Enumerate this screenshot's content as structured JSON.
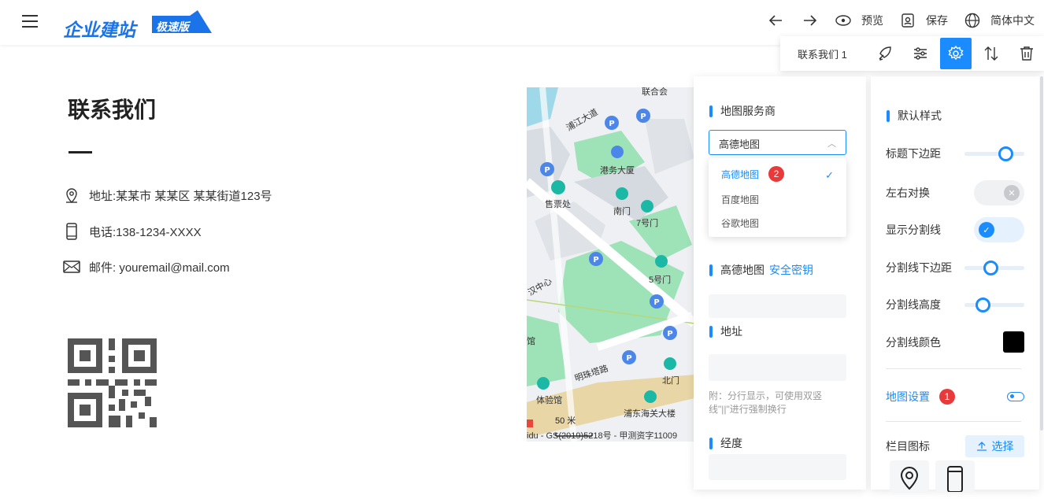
{
  "header": {
    "logo_text": "企业建站",
    "logo_tag": "极速版",
    "preview_label": "预览",
    "save_label": "保存",
    "language_label": "简体中文"
  },
  "toolbar": {
    "label": "联系我们 1"
  },
  "contact": {
    "title": "联系我们",
    "address": "地址:某某市 某某区 某某街道123号",
    "phone": "电话:138-1234-XXXX",
    "email": "邮件: youremail@mail.com"
  },
  "map": {
    "labels": [
      "浦江大道",
      "港务大厦",
      "售票处",
      "南门",
      "7号门",
      "5号门",
      "北门",
      "浦东海关大楼",
      "明珠塔路",
      "汉中心",
      "体验馆",
      "联合会",
      "馆"
    ],
    "scale": "50 米",
    "copyright": "idu - GS(2019)5218号 - 甲测资字11009"
  },
  "mid_panel": {
    "provider_title": "地图服务商",
    "provider_selected": "高德地图",
    "provider_options": [
      "高德地图",
      "百度地图",
      "谷歌地图"
    ],
    "provider_badge": "2",
    "amap_title": "高德地图",
    "amap_link": "安全密钥",
    "address_title": "地址",
    "address_hint": "附：分行显示，可使用双竖线\"||\"进行强制换行",
    "longitude_title": "经度"
  },
  "right_panel": {
    "default_style": "默认样式",
    "title_margin": "标题下边距",
    "swap_lr": "左右对换",
    "show_divider": "显示分割线",
    "divider_margin": "分割线下边距",
    "divider_height": "分割线高度",
    "divider_color": "分割线颜色",
    "divider_color_value": "#000000",
    "map_settings": "地图设置",
    "map_settings_badge": "1",
    "column_icon": "栏目图标",
    "choose_label": "选择",
    "title_margin_level": 0.75,
    "divider_margin_level": 0.42,
    "divider_height_level": 0.25,
    "swap_lr_on": false,
    "show_divider_on": true
  },
  "colors": {
    "accent": "#1a8cff",
    "badge": "#e83a3a"
  }
}
